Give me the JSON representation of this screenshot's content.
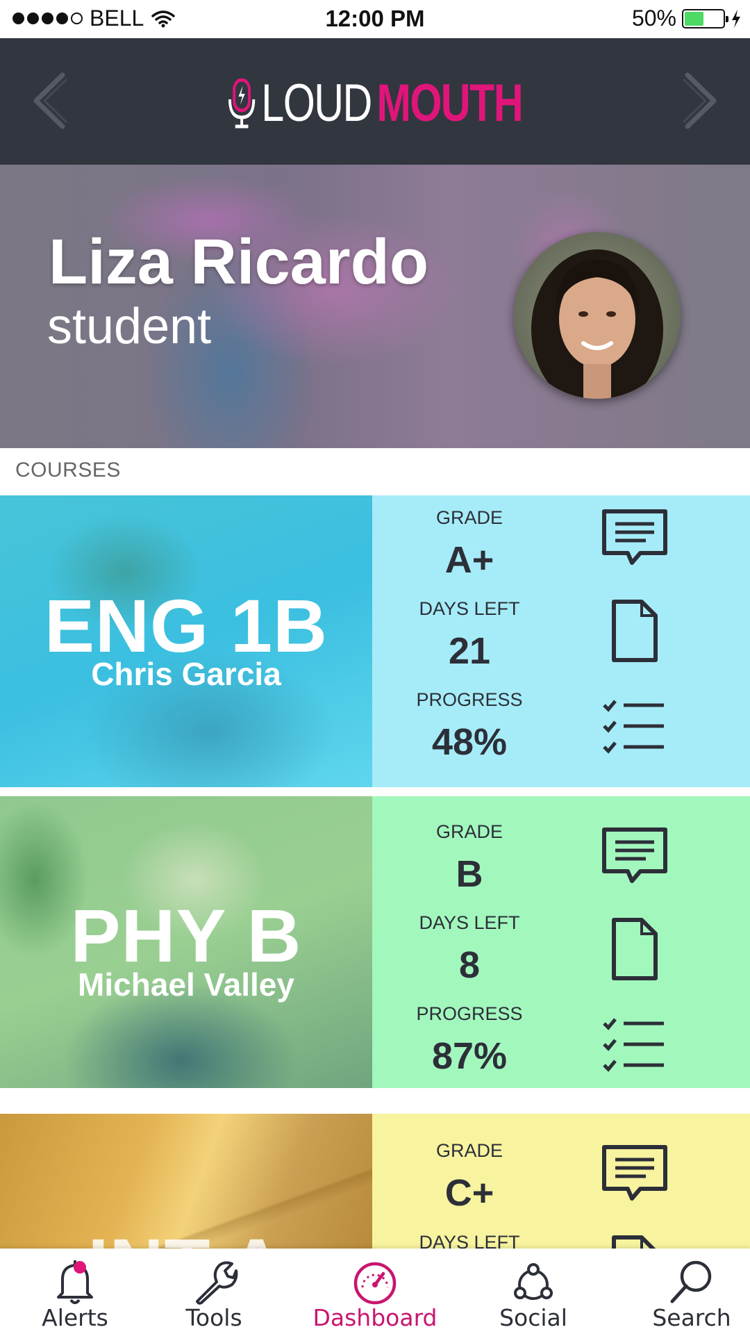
{
  "status_bar": {
    "carrier": "BELL",
    "time": "12:00 PM",
    "battery": "50%"
  },
  "header": {
    "logo_part1": "LOUD",
    "logo_part2": "MOUTH",
    "brand_color": "#e0157a"
  },
  "profile": {
    "name": "Liza Ricardo",
    "role": "student"
  },
  "courses_label": "COURSES",
  "courses": [
    {
      "code": "ENG 1B",
      "teacher": "Chris Garcia",
      "grade_label": "GRADE",
      "grade": "A+",
      "days_left_label": "DAYS LEFT",
      "days_left": "21",
      "progress_label": "PROGRESS",
      "progress": "48%",
      "panel_color": "#a6ecf8"
    },
    {
      "code": "PHY B",
      "teacher": "Michael Valley",
      "grade_label": "GRADE",
      "grade": "B",
      "days_left_label": "DAYS LEFT",
      "days_left": "8",
      "progress_label": "PROGRESS",
      "progress": "87%",
      "panel_color": "#a2f7bd"
    },
    {
      "code": "INT A",
      "grade_label": "GRADE",
      "grade": "C+",
      "days_left_label": "DAYS LEFT",
      "panel_color": "#f8f39f"
    }
  ],
  "tabs": [
    {
      "label": "Alerts",
      "icon": "bell-icon"
    },
    {
      "label": "Tools",
      "icon": "wrench-icon"
    },
    {
      "label": "Dashboard",
      "icon": "speedometer-icon",
      "active": true
    },
    {
      "label": "Social",
      "icon": "social-network-icon"
    },
    {
      "label": "Search",
      "icon": "search-icon"
    }
  ]
}
